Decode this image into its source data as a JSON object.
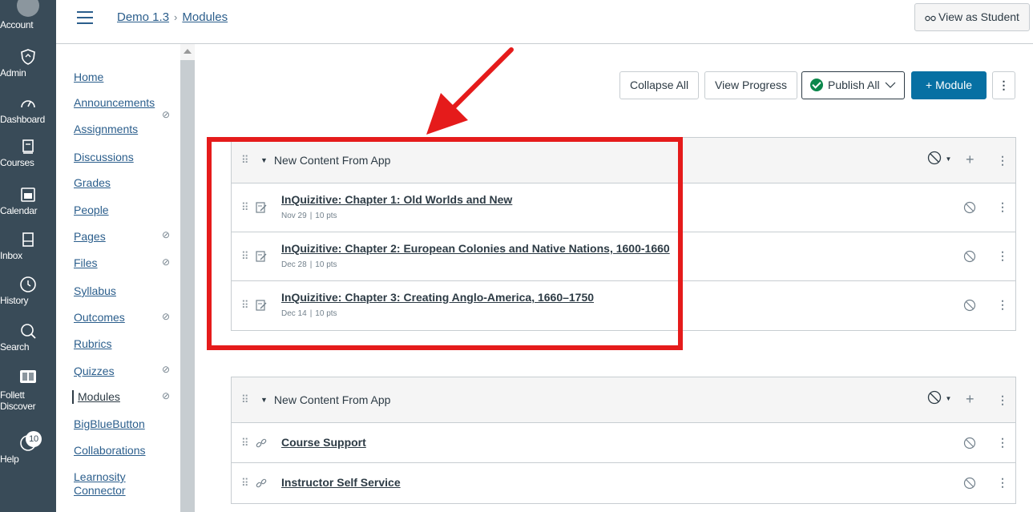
{
  "global_nav": {
    "items": [
      {
        "label": "Account",
        "icon": "account-icon"
      },
      {
        "label": "Admin",
        "icon": "admin-icon"
      },
      {
        "label": "Dashboard",
        "icon": "dashboard-icon"
      },
      {
        "label": "Courses",
        "icon": "courses-icon"
      },
      {
        "label": "Calendar",
        "icon": "calendar-icon"
      },
      {
        "label": "Inbox",
        "icon": "inbox-icon"
      },
      {
        "label": "History",
        "icon": "history-icon"
      },
      {
        "label": "Search",
        "icon": "search-icon"
      },
      {
        "label": "Follett Discover",
        "icon": "follett-icon"
      },
      {
        "label": "Help",
        "icon": "help-icon",
        "badge": "10"
      }
    ]
  },
  "header": {
    "breadcrumb": {
      "course": "Demo 1.3",
      "page": "Modules"
    },
    "view_as_student": "View as Student"
  },
  "course_nav": {
    "items": [
      {
        "label": "Home",
        "hidden": false
      },
      {
        "label": "Announcements",
        "hidden": false
      },
      {
        "label": "Assignments",
        "hidden": true
      },
      {
        "label": "Discussions",
        "hidden": false
      },
      {
        "label": "Grades",
        "hidden": false
      },
      {
        "label": "People",
        "hidden": false
      },
      {
        "label": "Pages",
        "hidden": true
      },
      {
        "label": "Files",
        "hidden": true
      },
      {
        "label": "Syllabus",
        "hidden": false
      },
      {
        "label": "Outcomes",
        "hidden": true
      },
      {
        "label": "Rubrics",
        "hidden": false
      },
      {
        "label": "Quizzes",
        "hidden": true
      },
      {
        "label": "Modules",
        "hidden": true,
        "active": true
      },
      {
        "label": "BigBlueButton",
        "hidden": false
      },
      {
        "label": "Collaborations",
        "hidden": false
      },
      {
        "label": "Learnosity Connector",
        "hidden": false
      }
    ]
  },
  "toolbar": {
    "collapse_all": "Collapse All",
    "view_progress": "View Progress",
    "publish_all": "Publish All",
    "add_module": "+ Module"
  },
  "modules": [
    {
      "title": "New Content From App",
      "items": [
        {
          "title": "InQuizitive: Chapter 1: Old Worlds and New",
          "date": "Nov 29",
          "points": "10 pts",
          "type": "assignment"
        },
        {
          "title": "InQuizitive: Chapter 2: European Colonies and Native Nations, 1600-1660",
          "date": "Dec 28",
          "points": "10 pts",
          "type": "assignment"
        },
        {
          "title": "InQuizitive: Chapter 3: Creating Anglo-America, 1660–1750",
          "date": "Dec 14",
          "points": "10 pts",
          "type": "assignment"
        }
      ]
    },
    {
      "title": "New Content From App",
      "items": [
        {
          "title": "Course Support",
          "type": "link"
        },
        {
          "title": "Instructor Self Service",
          "type": "link"
        }
      ]
    }
  ],
  "colors": {
    "global_nav_bg": "#394b58",
    "link": "#2b5e8c",
    "primary_button": "#0770a3",
    "published_green": "#0b874b",
    "annotation_red": "#e51b1b"
  }
}
